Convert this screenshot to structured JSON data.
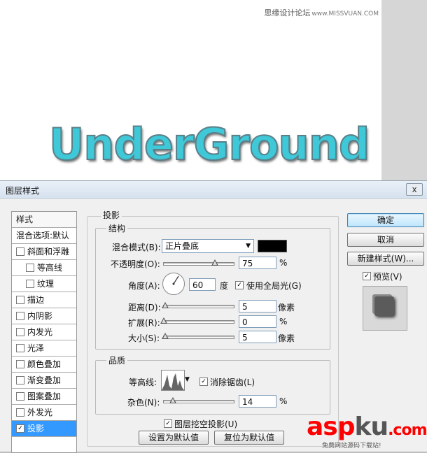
{
  "canvas": {
    "art_text": "UnderGround",
    "watermark_site": "思缘设计论坛",
    "watermark_url": "www.MISSVUAN.COM"
  },
  "dialog": {
    "title": "图层样式",
    "close": "x",
    "style_list": {
      "header": "样式",
      "blend_options": "混合选项:默认",
      "items": [
        {
          "label": "斜面和浮雕",
          "checked": false,
          "indent": false,
          "selected": false
        },
        {
          "label": "等高线",
          "checked": false,
          "indent": true,
          "selected": false
        },
        {
          "label": "纹理",
          "checked": false,
          "indent": true,
          "selected": false
        },
        {
          "label": "描边",
          "checked": false,
          "indent": false,
          "selected": false
        },
        {
          "label": "内阴影",
          "checked": false,
          "indent": false,
          "selected": false
        },
        {
          "label": "内发光",
          "checked": false,
          "indent": false,
          "selected": false
        },
        {
          "label": "光泽",
          "checked": false,
          "indent": false,
          "selected": false
        },
        {
          "label": "颜色叠加",
          "checked": false,
          "indent": false,
          "selected": false
        },
        {
          "label": "渐变叠加",
          "checked": false,
          "indent": false,
          "selected": false
        },
        {
          "label": "图案叠加",
          "checked": false,
          "indent": false,
          "selected": false
        },
        {
          "label": "外发光",
          "checked": false,
          "indent": false,
          "selected": false
        },
        {
          "label": "投影",
          "checked": true,
          "indent": false,
          "selected": true
        }
      ]
    },
    "panel_title": "投影",
    "structure": {
      "label": "结构",
      "blend_mode_label": "混合模式(B):",
      "blend_mode_value": "正片叠底",
      "shadow_color": "#000000",
      "opacity_label": "不透明度(O):",
      "opacity_value": "75",
      "opacity_unit": "%",
      "opacity_level": 0.75,
      "angle_label": "角度(A):",
      "angle_value": "60",
      "angle_unit": "度",
      "global_light_label": "使用全局光(G)",
      "global_light_checked": true,
      "distance_label": "距离(D):",
      "distance_value": "5",
      "distance_unit": "像素",
      "spread_label": "扩展(R):",
      "spread_value": "0",
      "spread_unit": "%",
      "size_label": "大小(S):",
      "size_value": "5",
      "size_unit": "像素"
    },
    "quality": {
      "label": "品质",
      "contour_label": "等高线:",
      "antialias_label": "消除锯齿(L)",
      "antialias_checked": true,
      "noise_label": "杂色(N):",
      "noise_value": "14",
      "noise_unit": "%"
    },
    "knockout_label": "图层挖空投影(U)",
    "knockout_checked": true,
    "make_default_label": "设置为默认值",
    "reset_default_label": "复位为默认值",
    "ok_label": "确定",
    "cancel_label": "取消",
    "new_style_label": "新建样式(W)...",
    "preview_label": "预览(V)",
    "preview_checked": true
  },
  "branding": {
    "logo_a": "asp",
    "logo_b": "ku",
    "logo_c": ".com",
    "logo_sub": "免费网站源码下载站!"
  }
}
